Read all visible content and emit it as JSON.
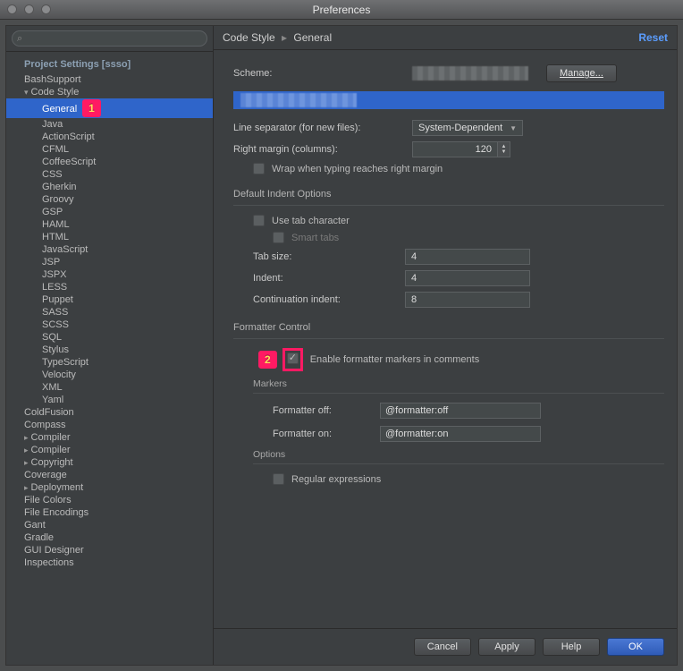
{
  "window": {
    "title": "Preferences"
  },
  "search": {
    "placeholder": ""
  },
  "sidebar": {
    "group_header": "Project Settings [ssso]",
    "top_items": [
      {
        "label": "BashSupport",
        "kind": "plain"
      },
      {
        "label": "Code Style",
        "kind": "expandable"
      }
    ],
    "code_style_children": [
      "General",
      "Java",
      "ActionScript",
      "CFML",
      "CoffeeScript",
      "CSS",
      "Gherkin",
      "Groovy",
      "GSP",
      "HAML",
      "HTML",
      "JavaScript",
      "JSP",
      "JSPX",
      "LESS",
      "Puppet",
      "SASS",
      "SCSS",
      "SQL",
      "Stylus",
      "TypeScript",
      "Velocity",
      "XML",
      "Yaml"
    ],
    "bottom_items": [
      {
        "label": "ColdFusion",
        "kind": "plain"
      },
      {
        "label": "Compass",
        "kind": "plain"
      },
      {
        "label": "Compiler",
        "kind": "collapsed"
      },
      {
        "label": "Compiler",
        "kind": "collapsed"
      },
      {
        "label": "Copyright",
        "kind": "collapsed"
      },
      {
        "label": "Coverage",
        "kind": "plain"
      },
      {
        "label": "Deployment",
        "kind": "collapsed"
      },
      {
        "label": "File Colors",
        "kind": "plain"
      },
      {
        "label": "File Encodings",
        "kind": "plain"
      },
      {
        "label": "Gant",
        "kind": "plain"
      },
      {
        "label": "Gradle",
        "kind": "plain"
      },
      {
        "label": "GUI Designer",
        "kind": "plain"
      },
      {
        "label": "Inspections",
        "kind": "plain"
      }
    ],
    "selected_child": "General"
  },
  "breadcrumb": {
    "a": "Code Style",
    "b": "General",
    "reset": "Reset"
  },
  "scheme": {
    "label": "Scheme:",
    "manage": "Manage..."
  },
  "line_separator": {
    "label": "Line separator (for new files):",
    "value": "System-Dependent"
  },
  "right_margin": {
    "label": "Right margin (columns):",
    "value": "120"
  },
  "wrap": {
    "label": "Wrap when typing reaches right margin"
  },
  "indent_section": {
    "title": "Default Indent Options"
  },
  "indent": {
    "use_tab": "Use tab character",
    "smart_tabs": "Smart tabs",
    "tab_size_label": "Tab size:",
    "tab_size": "4",
    "indent_label": "Indent:",
    "indent": "4",
    "cont_label": "Continuation indent:",
    "cont": "8"
  },
  "formatter": {
    "title": "Formatter Control",
    "enable_label": "Enable formatter markers in comments",
    "markers_title": "Markers",
    "off_label": "Formatter off:",
    "off_value": "@formatter:off",
    "on_label": "Formatter on:",
    "on_value": "@formatter:on",
    "options_title": "Options",
    "regex_label": "Regular expressions"
  },
  "footer": {
    "cancel": "Cancel",
    "apply": "Apply",
    "help": "Help",
    "ok": "OK"
  },
  "callouts": {
    "one": "1",
    "two": "2"
  }
}
